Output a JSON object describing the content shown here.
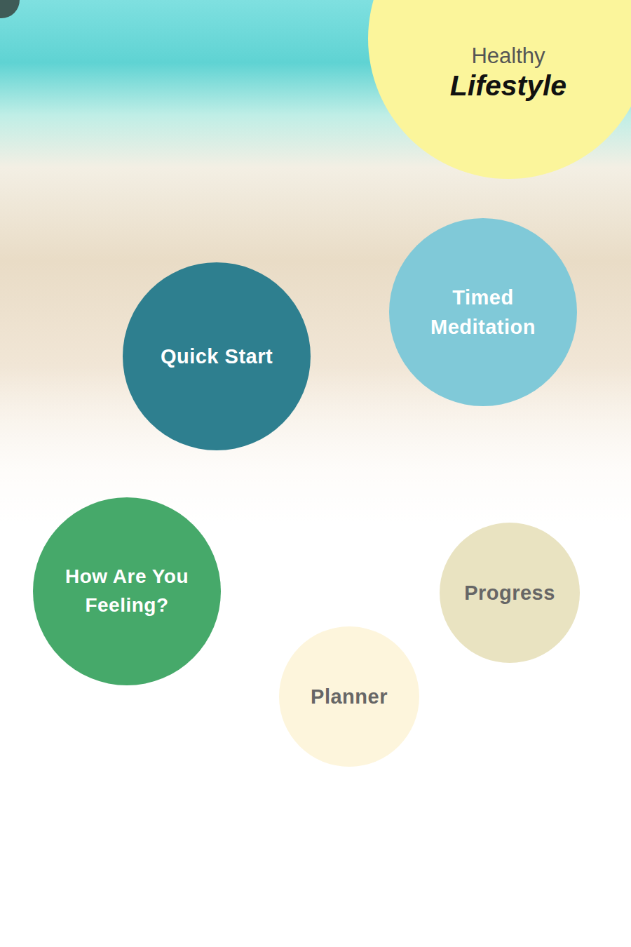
{
  "header": {
    "title_line1": "Healthy",
    "title_line2": "Lifestyle",
    "color": "#fbf59b"
  },
  "menu": [
    {
      "label": "Quick Start",
      "color": "#2e7f8f"
    },
    {
      "label": "Timed Meditation",
      "color": "#80c9d8"
    },
    {
      "label": "How Are You Feeling?",
      "color": "#46a96a"
    },
    {
      "label": "Progress",
      "color": "#e9e3c1"
    },
    {
      "label": "Planner",
      "color": "#fdf5dc"
    }
  ]
}
